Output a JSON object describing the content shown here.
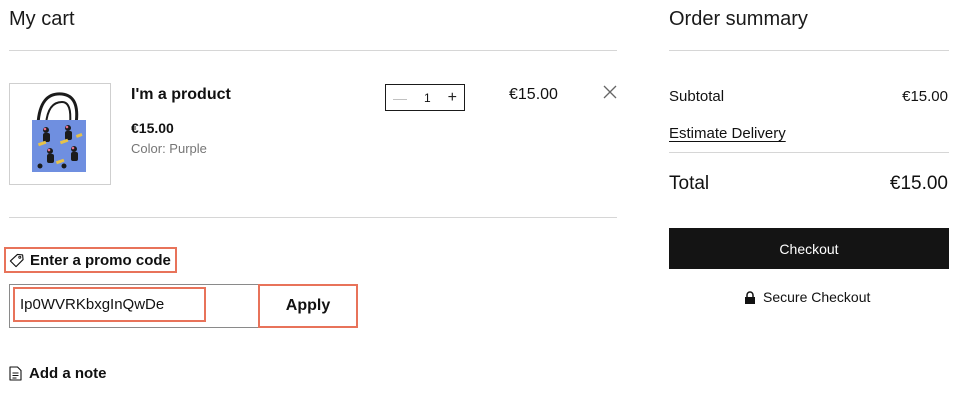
{
  "cart": {
    "title": "My cart",
    "item": {
      "name": "I'm a product",
      "price": "€15.00",
      "color": "Color: Purple",
      "quantity": "1",
      "line_total": "€15.00"
    },
    "promo": {
      "link_label": "Enter a promo code",
      "code_value": "Ip0WVRKbxgInQwDe",
      "apply_label": "Apply"
    },
    "note_label": "Add a note"
  },
  "summary": {
    "title": "Order summary",
    "subtotal_label": "Subtotal",
    "subtotal_value": "€15.00",
    "estimate_delivery_label": "Estimate Delivery",
    "total_label": "Total",
    "total_value": "€15.00",
    "checkout_label": "Checkout",
    "secure_label": "Secure Checkout"
  },
  "colors": {
    "highlight": "#e8735a",
    "checkout_bg": "#141414",
    "product_bg": "#6f8fe0"
  },
  "icons": {
    "promo": "tag-icon",
    "note": "note-icon",
    "secure": "lock-icon",
    "remove": "close-icon"
  }
}
